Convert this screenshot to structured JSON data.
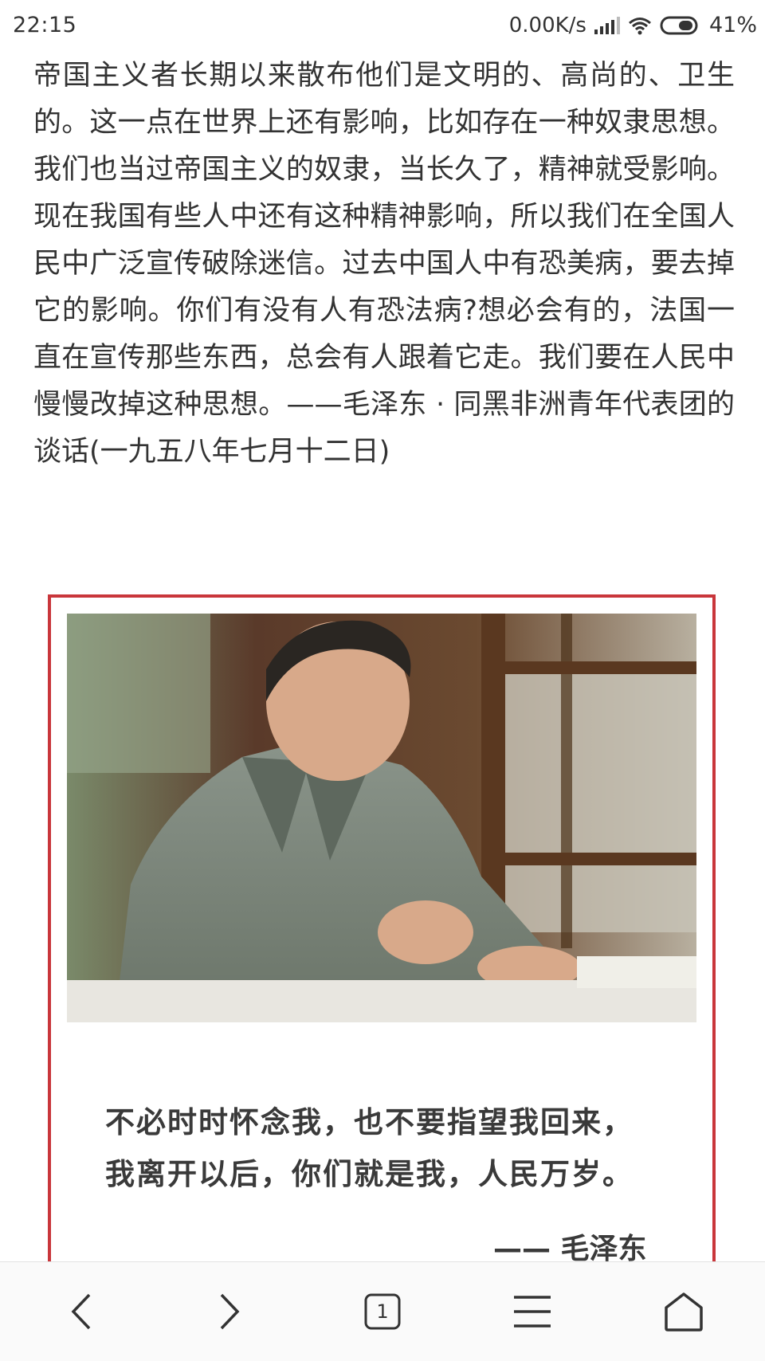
{
  "status_bar": {
    "time": "22:15",
    "network_speed": "0.00K/s",
    "battery": "41%",
    "icons": [
      "signal-icon",
      "wifi-icon",
      "battery-icon"
    ]
  },
  "article": {
    "paragraph": "帝国主义者长期以来散布他们是文明的、高尚的、卫生的。这一点在世界上还有影响，比如存在一种奴隶思想。我们也当过帝国主义的奴隶，当长久了，精神就受影响。现在我国有些人中还有这种精神影响，所以我们在全国人民中广泛宣传破除迷信。过去中国人中有恐美病，要去掉它的影响。你们有没有人有恐法病?想必会有的，法国一直在宣传那些东西，总会有人跟着它走。我们要在人民中慢慢改掉这种思想。——毛泽东 · 同黑非洲青年代表团的谈话(一九五八年七月十二日)"
  },
  "quote_card": {
    "border_color": "#c9363b",
    "line1": "不必时时怀念我，也不要指望我回来，",
    "line2": "我离开以后，你们就是我，人民万岁。",
    "signature": "—— 毛泽东"
  },
  "bottom_nav": {
    "tab_count": "1",
    "buttons": [
      "back-icon",
      "forward-icon",
      "tabs-icon",
      "menu-icon",
      "home-icon"
    ]
  }
}
